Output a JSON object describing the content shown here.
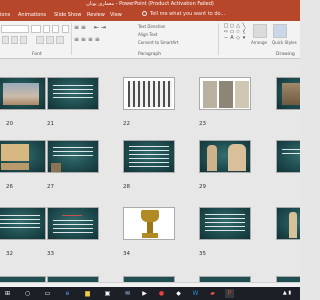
{
  "window": {
    "title": "معمارى يونان - PowerPoint (Product Activation Failed)"
  },
  "ribbon_tabs": [
    "ions",
    "Animations",
    "Slide Show",
    "Review",
    "View"
  ],
  "tell_me": {
    "placeholder": "Tell me what you want to do..."
  },
  "ribbon": {
    "bullets_glyph": "≡ ≡",
    "indent_glyph": "⇤ ⇥",
    "align_glyph": "≡ ≡ ≡ ≡",
    "text_direction": "Text Direction",
    "align_text": "Align Text",
    "convert_smartart": "Convert to SmartArt",
    "arrange": "Arrange",
    "quick_styles": "Quick Styles",
    "groups": {
      "font": "Font",
      "paragraph": "Paragraph",
      "drawing": "Drawing"
    }
  },
  "slide_rows": [
    [
      "20",
      "21",
      "22",
      "23",
      "24"
    ],
    [
      "26",
      "27",
      "28",
      "29",
      "30"
    ],
    [
      "32",
      "33",
      "34",
      "35",
      "36"
    ]
  ],
  "colors": {
    "accent": "#b7472a",
    "slide_bg": "#1f4d50",
    "taskbar": "#1d1f26"
  }
}
